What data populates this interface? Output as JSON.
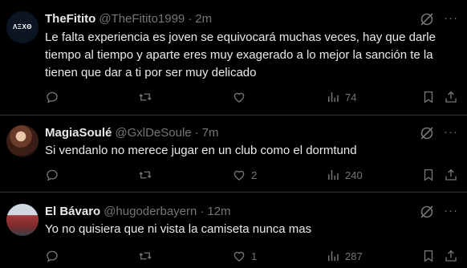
{
  "tweets": [
    {
      "name": "TheFitito",
      "handle": "@TheFitito1999",
      "time": "2m",
      "avatar_text": "ΛΞXΘ",
      "text": "Le falta experiencia es joven se equivocará muchas veces, hay que darle tiempo al tiempo y aparte eres muy exagerado a lo mejor la sanción te la tienen que dar a ti por ser muy delicado",
      "replies": "",
      "retweets": "",
      "likes": "",
      "views": "74"
    },
    {
      "name": "MagiaSoulé",
      "handle": "@GxlDeSoule",
      "time": "7m",
      "text": "Si vendanlo no merece jugar en un club como el dormtund",
      "replies": "",
      "retweets": "",
      "likes": "2",
      "views": "240"
    },
    {
      "name": "El Bávaro",
      "handle": "@hugoderbayern",
      "time": "12m",
      "text": "Yo no quisiera que ni vista la camiseta nunca mas",
      "replies": "",
      "retweets": "",
      "likes": "1",
      "views": "287"
    }
  ],
  "separator": "·",
  "colors": {
    "background": "#000000",
    "text": "#e7e9ea",
    "muted": "#71767b",
    "divider": "#2f3336"
  },
  "icons": [
    "reply-icon",
    "retweet-icon",
    "like-icon",
    "views-icon",
    "bookmark-icon",
    "share-icon",
    "grok-icon",
    "more-icon"
  ]
}
